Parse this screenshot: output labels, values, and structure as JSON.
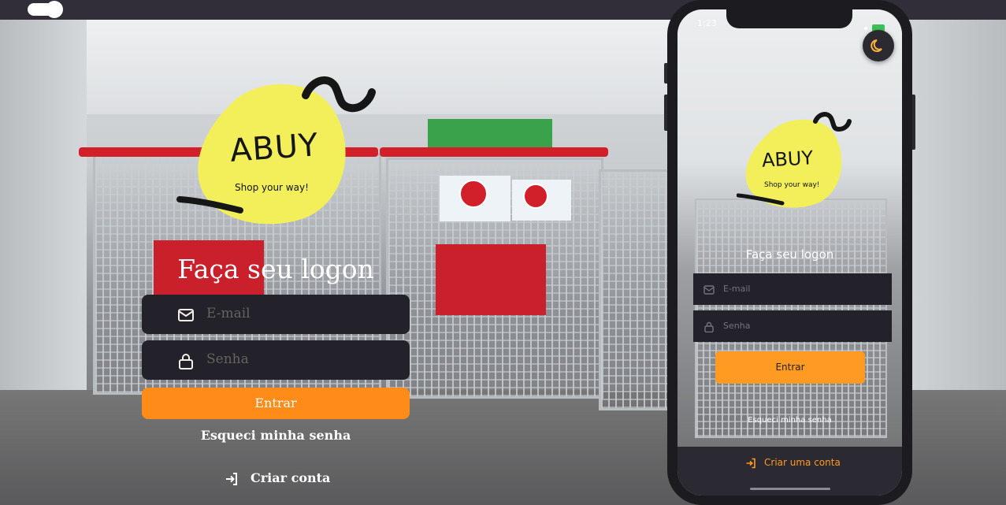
{
  "top_bar": {
    "theme_toggle": "on"
  },
  "brand": {
    "name": "ABUY",
    "tagline": "Shop your way!",
    "colors": {
      "accent": "#ff8c18",
      "logo_blob": "#f3ef5b",
      "field_bg": "#232129"
    }
  },
  "login": {
    "title": "Faça seu logon",
    "email_placeholder": "E-mail",
    "password_placeholder": "Senha",
    "submit_label": "Entrar",
    "forgot_label": "Esqueci minha senha",
    "create_label": "Criar conta"
  },
  "phone": {
    "time": "1:23",
    "title": "Faça seu logon",
    "email_placeholder": "E-mail",
    "password_placeholder": "Senha",
    "submit_label": "Entrar",
    "forgot_label": "Esqueci minha senha",
    "create_label": "Criar uma conta",
    "theme_icon": "moon-icon"
  }
}
